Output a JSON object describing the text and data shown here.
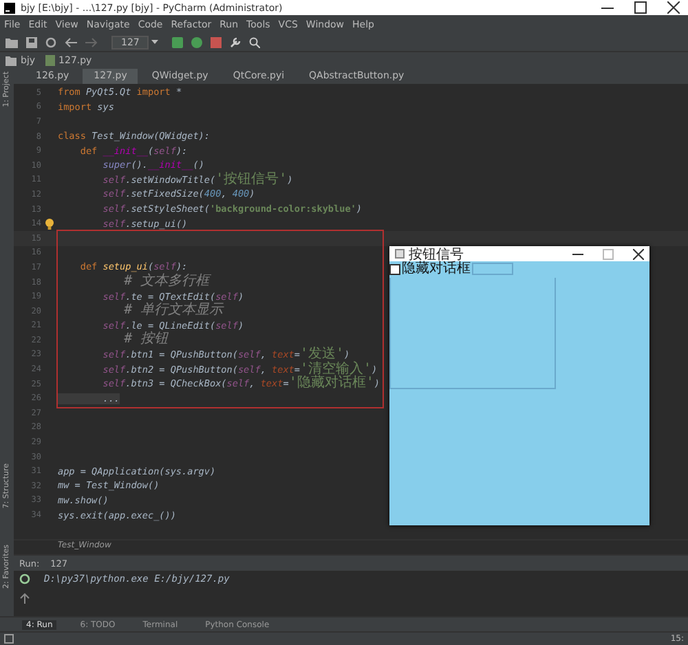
{
  "window": {
    "title": "bjy [E:\\bjy] - ...\\127.py [bjy] - PyCharm (Administrator)"
  },
  "menu": [
    "File",
    "Edit",
    "View",
    "Navigate",
    "Code",
    "Refactor",
    "Run",
    "Tools",
    "VCS",
    "Window",
    "Help"
  ],
  "toolbar": {
    "run_config": "127"
  },
  "breadcrumb": [
    "bjy",
    "127.py"
  ],
  "tabs": [
    {
      "label": "126.py",
      "selected": false
    },
    {
      "label": "127.py",
      "selected": true
    },
    {
      "label": "QWidget.py",
      "selected": false
    },
    {
      "label": "QtCore.pyi",
      "selected": false
    },
    {
      "label": "QAbstractButton.py",
      "selected": false
    }
  ],
  "side_top": [
    "1: Project"
  ],
  "side_bottom": [
    "7: Structure",
    "2: Favorites"
  ],
  "editor": {
    "lines": [
      {
        "number": "5",
        "current": false,
        "hint": false,
        "tokens": [
          {
            "kind": "kw",
            "text": "from"
          },
          {
            "kind": "plain",
            "text": " PyQt5.Qt "
          },
          {
            "kind": "kw",
            "text": "import"
          },
          {
            "kind": "plain",
            "text": " *"
          }
        ]
      },
      {
        "number": "6",
        "current": false,
        "hint": false,
        "tokens": [
          {
            "kind": "kw",
            "text": "import"
          },
          {
            "kind": "plain",
            "text": " sys"
          }
        ]
      },
      {
        "number": "7",
        "current": false,
        "hint": false
      },
      {
        "number": "8",
        "current": false,
        "hint": false,
        "tokens": [
          {
            "kind": "kw",
            "text": "class"
          },
          {
            "kind": "plain",
            "text": " Test_Window(QWidget):"
          }
        ]
      },
      {
        "number": "9",
        "current": false,
        "hint": false,
        "tokens": [
          {
            "kind": "kw",
            "text": "    def"
          },
          {
            "kind": "magic",
            "text": " __init__"
          },
          {
            "kind": "plain",
            "text": "("
          },
          {
            "kind": "self",
            "text": "self"
          },
          {
            "kind": "plain",
            "text": "):"
          }
        ]
      },
      {
        "number": "10",
        "current": false,
        "hint": false,
        "tokens": [
          {
            "kind": "builtin",
            "text": "        super"
          },
          {
            "kind": "plain",
            "text": "()."
          },
          {
            "kind": "magic",
            "text": "__init__"
          },
          {
            "kind": "plain",
            "text": "()"
          }
        ]
      },
      {
        "number": "11",
        "current": false,
        "hint": false,
        "tokens": [
          {
            "kind": "self",
            "text": "        self"
          },
          {
            "kind": "plain",
            "text": ".setWindowTitle("
          },
          {
            "kind": "str_cjk",
            "text": "'按钮信号'"
          },
          {
            "kind": "plain",
            "text": ")"
          }
        ]
      },
      {
        "number": "12",
        "current": false,
        "hint": false,
        "tokens": [
          {
            "kind": "self",
            "text": "        self"
          },
          {
            "kind": "plain",
            "text": ".setFixedSize("
          },
          {
            "kind": "num",
            "text": "400"
          },
          {
            "kind": "plain",
            "text": ", "
          },
          {
            "kind": "num",
            "text": "400"
          },
          {
            "kind": "plain",
            "text": ")"
          }
        ]
      },
      {
        "number": "13",
        "current": false,
        "hint": false,
        "tokens": [
          {
            "kind": "self",
            "text": "        self"
          },
          {
            "kind": "plain",
            "text": ".setStyleSheet("
          },
          {
            "kind": "str",
            "text": "'background-color:skyblue'"
          },
          {
            "kind": "plain",
            "text": ")"
          }
        ]
      },
      {
        "number": "14",
        "current": false,
        "hint": true,
        "tokens": [
          {
            "kind": "self",
            "text": "        self"
          },
          {
            "kind": "plain",
            "text": ".setup_ui()"
          }
        ]
      },
      {
        "number": "15",
        "current": true,
        "hint": false
      },
      {
        "number": "16",
        "current": false,
        "hint": false
      },
      {
        "number": "17",
        "current": false,
        "hint": false,
        "tokens": [
          {
            "kind": "kw",
            "text": "    def"
          },
          {
            "kind": "func",
            "text": " setup_ui"
          },
          {
            "kind": "plain",
            "text": "("
          },
          {
            "kind": "self",
            "text": "self"
          },
          {
            "kind": "plain",
            "text": "):"
          }
        ]
      },
      {
        "number": "18",
        "current": false,
        "hint": false,
        "tokens": [
          {
            "kind": "comment",
            "text": "        # 文本多行框"
          }
        ]
      },
      {
        "number": "19",
        "current": false,
        "hint": false,
        "tokens": [
          {
            "kind": "self",
            "text": "        self"
          },
          {
            "kind": "plain",
            "text": ".te = QTextEdit("
          },
          {
            "kind": "self",
            "text": "self"
          },
          {
            "kind": "plain",
            "text": ")"
          }
        ]
      },
      {
        "number": "20",
        "current": false,
        "hint": false,
        "tokens": [
          {
            "kind": "comment",
            "text": "        # 单行文本显示"
          }
        ]
      },
      {
        "number": "21",
        "current": false,
        "hint": false,
        "tokens": [
          {
            "kind": "self",
            "text": "        self"
          },
          {
            "kind": "plain",
            "text": ".le = QLineEdit("
          },
          {
            "kind": "self",
            "text": "self"
          },
          {
            "kind": "plain",
            "text": ")"
          }
        ]
      },
      {
        "number": "22",
        "current": false,
        "hint": false,
        "tokens": [
          {
            "kind": "comment",
            "text": "        # 按钮"
          }
        ]
      },
      {
        "number": "23",
        "current": false,
        "hint": false,
        "tokens": [
          {
            "kind": "self",
            "text": "        self"
          },
          {
            "kind": "plain",
            "text": ".btn1 = QPushButton("
          },
          {
            "kind": "self",
            "text": "self"
          },
          {
            "kind": "plain",
            "text": ", "
          },
          {
            "kind": "param",
            "text": "text"
          },
          {
            "kind": "plain",
            "text": "="
          },
          {
            "kind": "str_cjk",
            "text": "'发送'"
          },
          {
            "kind": "plain",
            "text": ")"
          }
        ]
      },
      {
        "number": "24",
        "current": false,
        "hint": false,
        "tokens": [
          {
            "kind": "self",
            "text": "        self"
          },
          {
            "kind": "plain",
            "text": ".btn2 = QPushButton("
          },
          {
            "kind": "self",
            "text": "self"
          },
          {
            "kind": "plain",
            "text": ", "
          },
          {
            "kind": "param",
            "text": "text"
          },
          {
            "kind": "plain",
            "text": "="
          },
          {
            "kind": "str_cjk",
            "text": "'清空输入'"
          },
          {
            "kind": "plain",
            "text": ")"
          }
        ]
      },
      {
        "number": "25",
        "current": false,
        "hint": false,
        "tokens": [
          {
            "kind": "self",
            "text": "        self"
          },
          {
            "kind": "plain",
            "text": ".btn3 = QCheckBox("
          },
          {
            "kind": "self",
            "text": "self"
          },
          {
            "kind": "plain",
            "text": ", "
          },
          {
            "kind": "param",
            "text": "text"
          },
          {
            "kind": "plain",
            "text": "="
          },
          {
            "kind": "str_cjk",
            "text": "'隐藏对话框'"
          },
          {
            "kind": "plain",
            "text": ")"
          }
        ]
      },
      {
        "number": "26",
        "current": false,
        "hint": false,
        "tokens": [
          {
            "kind": "fold",
            "text": "        ..."
          }
        ]
      },
      {
        "number": "27",
        "current": false,
        "hint": false
      },
      {
        "number": "28",
        "current": false,
        "hint": false
      },
      {
        "number": "29",
        "current": false,
        "hint": false
      },
      {
        "number": "30",
        "current": false,
        "hint": false
      },
      {
        "number": "31",
        "current": false,
        "hint": false,
        "tokens": [
          {
            "kind": "plain",
            "text": "app = QApplication(sys.argv)"
          }
        ]
      },
      {
        "number": "32",
        "current": false,
        "hint": false,
        "tokens": [
          {
            "kind": "plain",
            "text": "mw = Test_Window()"
          }
        ]
      },
      {
        "number": "33",
        "current": false,
        "hint": false,
        "tokens": [
          {
            "kind": "plain",
            "text": "mw.show()"
          }
        ]
      },
      {
        "number": "34",
        "current": false,
        "hint": false,
        "tokens": [
          {
            "kind": "plain",
            "text": "sys.exit(app.exec_())"
          }
        ]
      }
    ]
  },
  "breadcrumb_bottom": "Test_Window",
  "qt_window": {
    "title": "按钮信号",
    "checkbox": {
      "label": "隐藏对话框",
      "checked": false
    }
  },
  "run": {
    "label": "Run:",
    "config": "127",
    "output": "D:\\py37\\python.exe E:/bjy/127.py"
  },
  "bottom_tabs": [
    {
      "label": "4: Run",
      "selected": true
    },
    {
      "label": "6: TODO",
      "selected": false
    },
    {
      "label": "Terminal",
      "selected": false
    },
    {
      "label": "Python Console",
      "selected": false
    }
  ],
  "status": "15:"
}
